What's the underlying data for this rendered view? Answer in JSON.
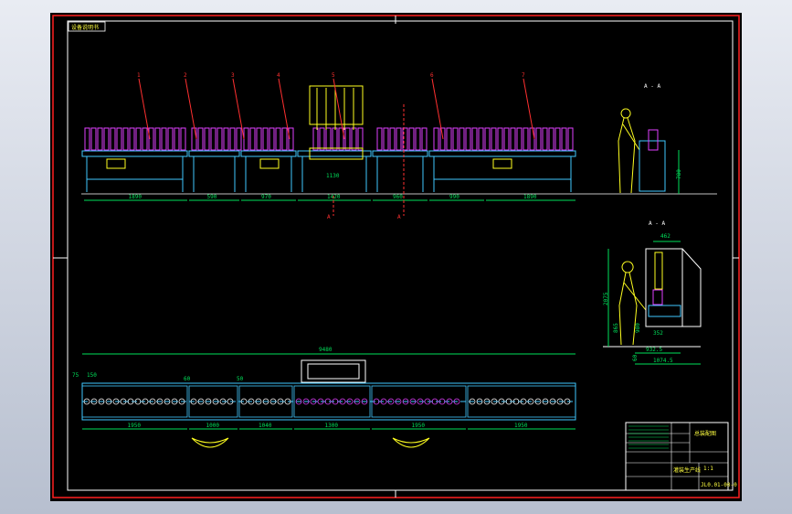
{
  "window": {
    "title": "CAD drawing viewport"
  },
  "drawing": {
    "corner_tag": "设备说明书",
    "front_view": {
      "balloons": [
        "1",
        "2",
        "3",
        "4",
        "5",
        "6",
        "7"
      ],
      "dims": [
        "1890",
        "590",
        "970",
        "1420",
        "960",
        "990",
        "1890"
      ],
      "section_labels": [
        "A",
        "A"
      ],
      "height_right": "780",
      "section_title": "A - A",
      "tank_value": "1130"
    },
    "side_view": {
      "title": "A - A",
      "top_dim": "462",
      "height_left": "2075",
      "height_mid": "865",
      "lower_dim": "980",
      "bottom_dim_1": "932.5",
      "bottom_dim_2": "1074.5",
      "short_dim": "60",
      "small_dim": "352"
    },
    "plan_view": {
      "overall": "9480",
      "dims_bottom": [
        "1950",
        "1000",
        "1040",
        "1300",
        "1950",
        "1950"
      ],
      "dims_top": [
        "75",
        "150",
        "60",
        "50"
      ]
    },
    "title_block": {
      "drawing_no": "JL0.01-00-0",
      "scale": "1:1",
      "name": "灌装生产线",
      "assembly_label": "总装配图"
    }
  },
  "colors": {
    "background": "#000000",
    "border": "#ff2020",
    "frame": "#ffffff",
    "conveyor": "#40c8ff",
    "rollers": "#e040ff",
    "dimensions": "#00e05a",
    "figure": "#ffff20",
    "leaders": "#ff3030"
  }
}
